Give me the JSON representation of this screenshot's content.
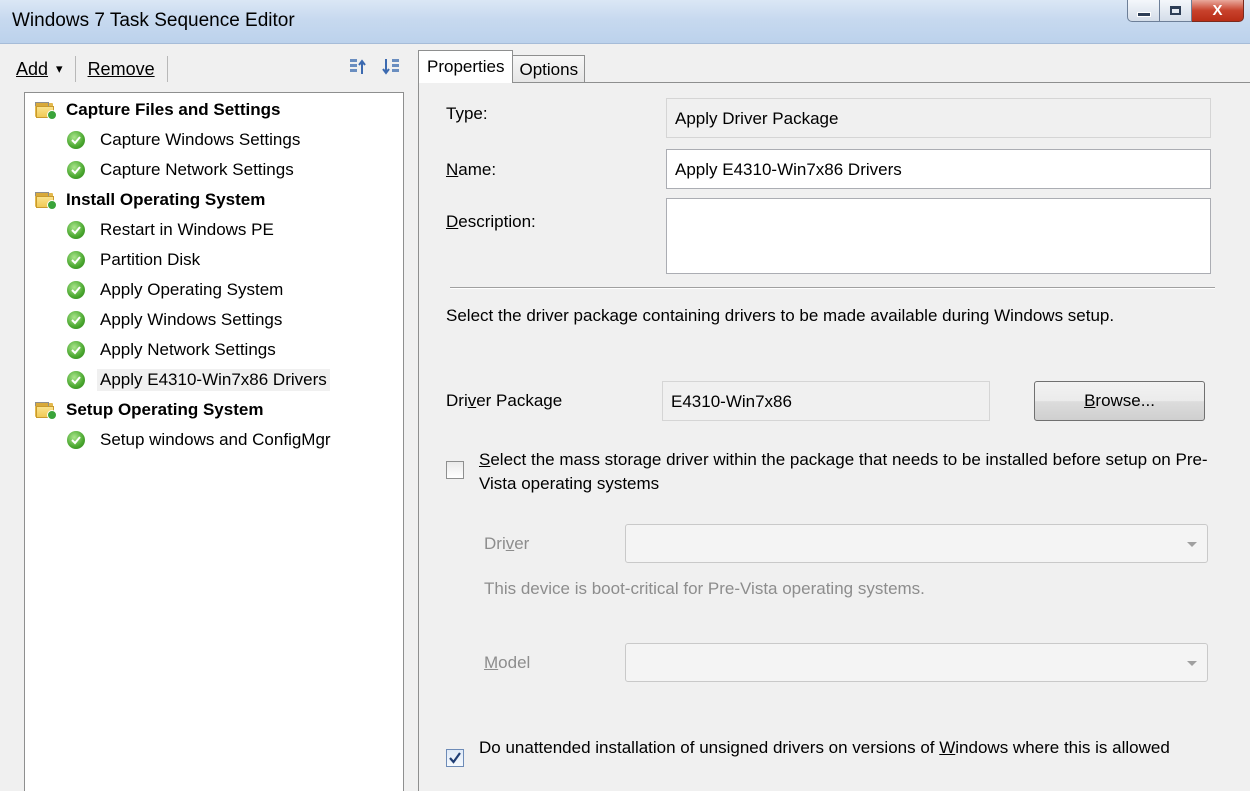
{
  "window": {
    "title": "Windows 7 Task Sequence Editor",
    "close_glyph": "X"
  },
  "toolbar": {
    "add_label": "Add",
    "add_dropdown_glyph": "▾",
    "remove_label": "Remove",
    "icons": [
      "move-up-icon",
      "move-down-icon"
    ]
  },
  "tree": {
    "items": [
      {
        "label": "Capture Files and Settings",
        "type": "group"
      },
      {
        "label": "Capture Windows Settings",
        "type": "step"
      },
      {
        "label": "Capture Network Settings",
        "type": "step"
      },
      {
        "label": "Install Operating System",
        "type": "group"
      },
      {
        "label": "Restart in Windows PE",
        "type": "step"
      },
      {
        "label": "Partition Disk",
        "type": "step"
      },
      {
        "label": "Apply Operating System",
        "type": "step"
      },
      {
        "label": "Apply Windows Settings",
        "type": "step"
      },
      {
        "label": "Apply Network Settings",
        "type": "step"
      },
      {
        "label": "Apply E4310-Win7x86 Drivers",
        "type": "step",
        "selected": true
      },
      {
        "label": "Setup Operating System",
        "type": "group"
      },
      {
        "label": "Setup windows and ConfigMgr",
        "type": "step"
      }
    ]
  },
  "tabs": [
    {
      "label": "Properties",
      "active": true
    },
    {
      "label": "Options",
      "active": false
    }
  ],
  "properties": {
    "type_label": "Type:",
    "type_value": "Apply Driver Package",
    "name_label": "Name:",
    "name_value": "Apply E4310-Win7x86 Drivers",
    "description_label": "Description:",
    "description_value": "",
    "instructions": "Select the driver package containing drivers to be made available during Windows setup.",
    "driver_package_label": "Driver Package",
    "driver_package_value": "E4310-Win7x86",
    "browse_label": "Browse...",
    "mass_storage_checkbox": {
      "checked": false,
      "label": "Select the mass storage driver within the package that needs to be installed before setup on Pre-Vista operating systems"
    },
    "driver_label": "Driver",
    "driver_value": "",
    "boot_critical_note": "This device is boot-critical for Pre-Vista operating systems.",
    "model_label": "Model",
    "model_value": "",
    "unsigned_checkbox": {
      "checked": true,
      "label": "Do unattended installation of unsigned drivers on versions of Windows where this is allowed"
    }
  },
  "colors": {
    "titlebar": "#c7d9ef",
    "window_bg": "#f0f0f0",
    "ok_green": "#4aa72f",
    "folder_yellow": "#f0c956",
    "close_red": "#c8422c"
  }
}
